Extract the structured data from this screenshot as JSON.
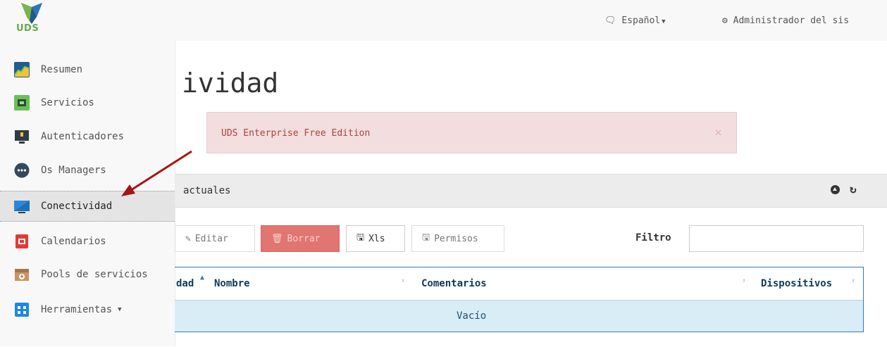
{
  "header": {
    "logo_text": "UDS",
    "language": "Español",
    "user": "Administrador del sis"
  },
  "sidebar": {
    "items": [
      {
        "label": "Resumen",
        "icon": "chart-icon",
        "color": "#1c5f8f"
      },
      {
        "label": "Servicios",
        "icon": "board-icon",
        "color": "#4caf50"
      },
      {
        "label": "Autenticadores",
        "icon": "monitor-lock-icon",
        "color": "#2f3b4a"
      },
      {
        "label": "Os Managers",
        "icon": "dots-icon",
        "color": "#34495e"
      },
      {
        "label": "Conectividad",
        "icon": "monitor-icon",
        "color": "#2b88d8"
      },
      {
        "label": "Calendarios",
        "icon": "calendar-icon",
        "color": "#e53935"
      },
      {
        "label": "Pools de servicios",
        "icon": "box-icon",
        "color": "#b08050"
      },
      {
        "label": "Herramientas",
        "icon": "tools-icon",
        "color": "#1e88e5"
      }
    ]
  },
  "main": {
    "title": "ividad",
    "alert_text": "UDS Enterprise Free Edition",
    "alert_close": "×",
    "panel_title": "actuales",
    "buttons": {
      "edit": "Editar",
      "delete": "Borrar",
      "xls": "Xls",
      "permissions": "Permisos"
    },
    "filter_label": "Filtro",
    "filter_value": "",
    "columns": [
      "dad",
      "Nombre",
      "Comentarios",
      "Dispositivos"
    ],
    "empty_text": "Vacío"
  }
}
